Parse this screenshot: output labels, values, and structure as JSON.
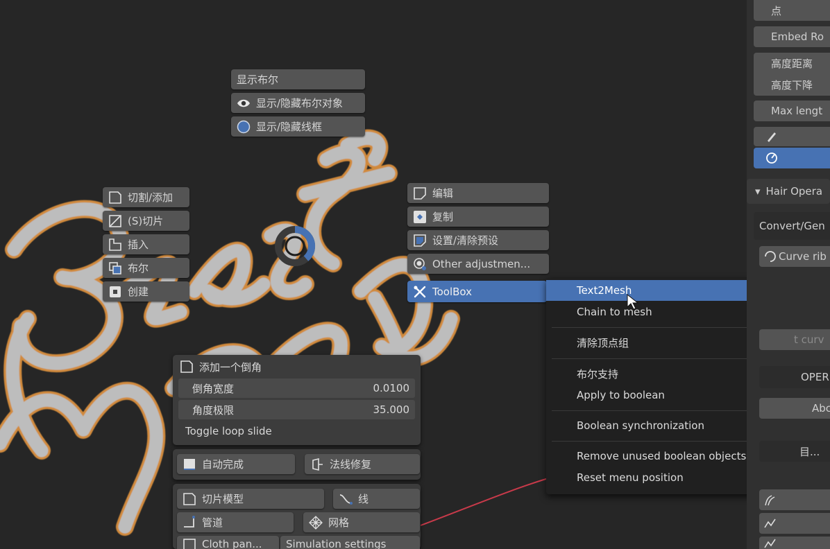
{
  "boolean_group": {
    "header": "显示布尔",
    "toggle_objects": "显示/隐藏布尔对象",
    "toggle_wire": "显示/隐藏线框"
  },
  "left_pie": {
    "cut_add": "切割/添加",
    "slice": "(S)切片",
    "insert": "插入",
    "boolean": "布尔",
    "create": "创建"
  },
  "right_pie": {
    "edit": "编辑",
    "copy": "复制",
    "set_clear": "设置/清除预设",
    "other": "Other adjustmen...",
    "toolbox": "ToolBox"
  },
  "toolbox_menu": {
    "items": [
      "Text2Mesh",
      "Chain to mesh",
      "清除顶点组",
      "布尔支持",
      "Apply to boolean",
      "Boolean synchronization",
      "Remove unused boolean objects",
      "Reset menu position"
    ]
  },
  "bevel_panel": {
    "header": "添加一个倒角",
    "width_label": "倒角宽度",
    "width_value": "0.0100",
    "angle_label": "角度极限",
    "angle_value": "35.000",
    "toggle": "Toggle loop slide"
  },
  "bottom_buttons": {
    "auto_complete": "自动完成",
    "normal_fix": "法线修复",
    "slice_model": "切片模型",
    "line": "线",
    "strip": "管道",
    "mesh": "网格",
    "cloth": "Cloth pan...",
    "simulation": "Simulation settings"
  },
  "right_panel": {
    "dot": "点",
    "embed": "Embed Ro",
    "height_distance": "高度距离",
    "height_drop": "高度下降",
    "max_length": "Max lengt",
    "hair_ops": "Hair Opera",
    "convert": "Convert/Gen",
    "curve_rib": "Curve rib",
    "curve_partial": "t curv",
    "oper_partial": "OPER",
    "abc_partial": "Abc",
    "mesh_partial": "目..."
  },
  "colors": {
    "button": "#545454",
    "active": "#4772b3",
    "menu": "#202020",
    "viewport": "#262626",
    "text_fill": "#bdbdbd",
    "text_outline": "#d08a3c",
    "red_line": "#c83a4a"
  }
}
